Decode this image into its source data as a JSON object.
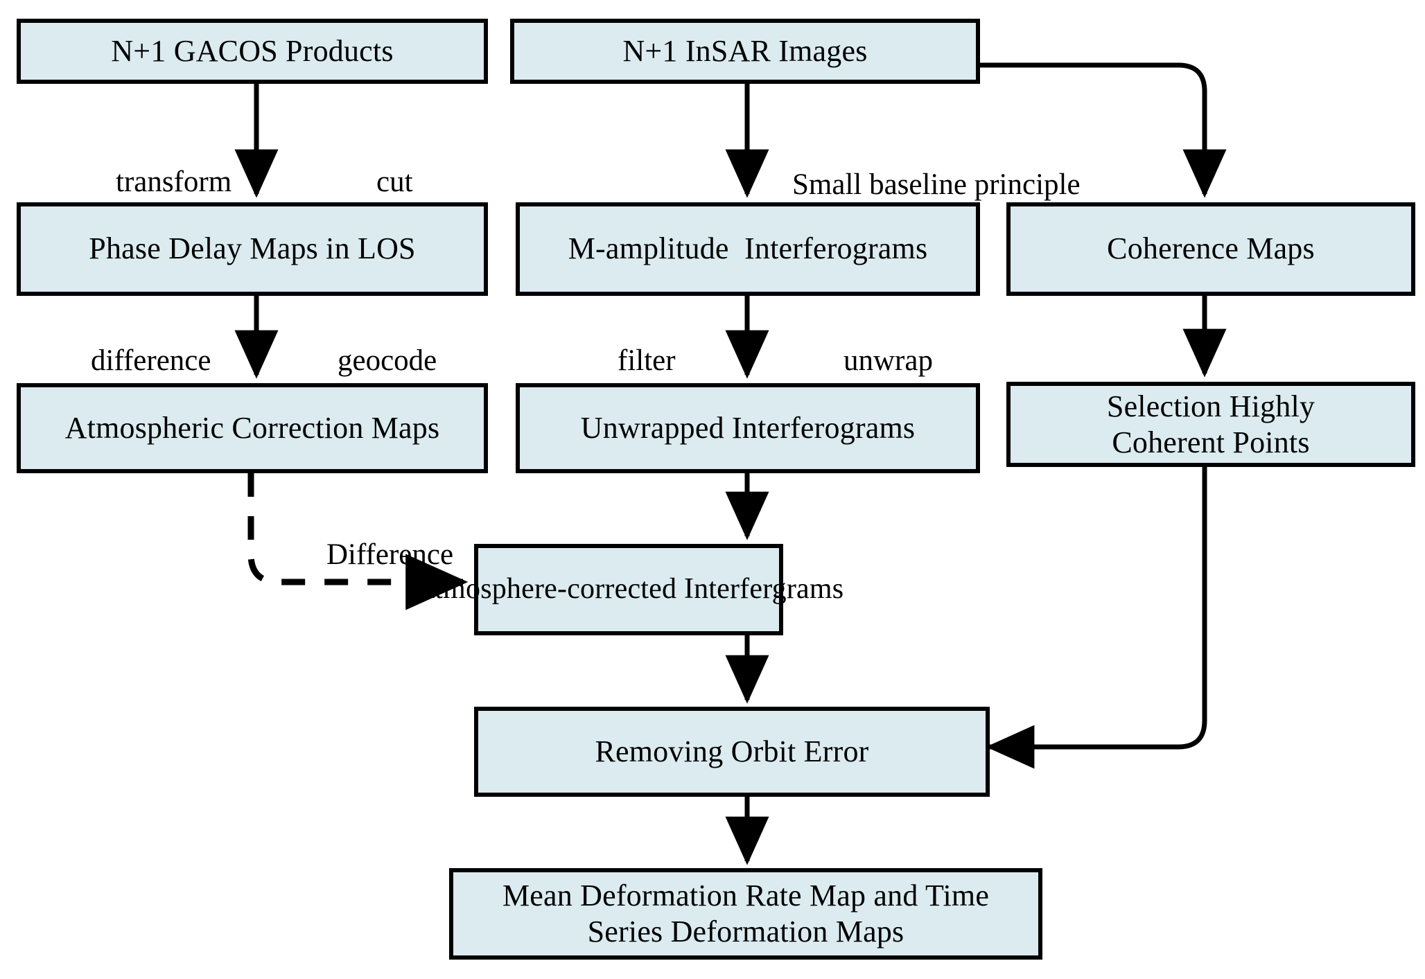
{
  "diagram": {
    "title_present": false,
    "background_color": "#ffffff",
    "node_fill_color": "#dbebf0",
    "node_border_color": "#000000",
    "text_color": "#000000",
    "nodes": [
      {
        "id": "gacos",
        "label": "N+1 GACOS Products"
      },
      {
        "id": "insar",
        "label": "N+1 InSAR Images"
      },
      {
        "id": "phase_delay",
        "label": "Phase Delay Maps in LOS"
      },
      {
        "id": "mamp",
        "label": "M-amplitude  Interferograms"
      },
      {
        "id": "coherence",
        "label": "Coherence Maps"
      },
      {
        "id": "atmo_corr",
        "label": "Atmospheric Correction Maps"
      },
      {
        "id": "unwrapped",
        "label": "Unwrapped Interferograms"
      },
      {
        "id": "selection",
        "label": "Selection Highly\nCoherent Points"
      },
      {
        "id": "atmo_interf",
        "label": "Atmosphere-corrected Interfergrams"
      },
      {
        "id": "orbit",
        "label": "Removing Orbit Error"
      },
      {
        "id": "result",
        "label": "Mean Deformation Rate Map and Time\nSeries Deformation Maps"
      }
    ],
    "edge_labels": [
      {
        "id": "transform",
        "text": "transform"
      },
      {
        "id": "cut",
        "text": "cut"
      },
      {
        "id": "small_base",
        "text": "Small baseline principle"
      },
      {
        "id": "difference",
        "text": "difference"
      },
      {
        "id": "geocode",
        "text": "geocode"
      },
      {
        "id": "filter",
        "text": "filter"
      },
      {
        "id": "unwrap",
        "text": "unwrap"
      },
      {
        "id": "difference2",
        "text": "Difference"
      }
    ],
    "edges": [
      {
        "from": "gacos",
        "to": "phase_delay",
        "style": "solid",
        "labels": [
          "transform",
          "cut"
        ]
      },
      {
        "from": "insar",
        "to": "mamp",
        "style": "solid",
        "labels": [
          "Small baseline principle"
        ]
      },
      {
        "from": "insar",
        "to": "coherence",
        "style": "solid",
        "labels": []
      },
      {
        "from": "phase_delay",
        "to": "atmo_corr",
        "style": "solid",
        "labels": [
          "difference",
          "geocode"
        ]
      },
      {
        "from": "mamp",
        "to": "unwrapped",
        "style": "solid",
        "labels": [
          "filter",
          "unwrap"
        ]
      },
      {
        "from": "coherence",
        "to": "selection",
        "style": "solid",
        "labels": []
      },
      {
        "from": "atmo_corr",
        "to": "atmo_interf",
        "style": "dashed",
        "labels": [
          "Difference"
        ]
      },
      {
        "from": "unwrapped",
        "to": "atmo_interf",
        "style": "solid",
        "labels": []
      },
      {
        "from": "atmo_interf",
        "to": "orbit",
        "style": "solid",
        "labels": []
      },
      {
        "from": "selection",
        "to": "orbit",
        "style": "solid",
        "labels": []
      },
      {
        "from": "orbit",
        "to": "result",
        "style": "solid",
        "labels": []
      }
    ]
  }
}
